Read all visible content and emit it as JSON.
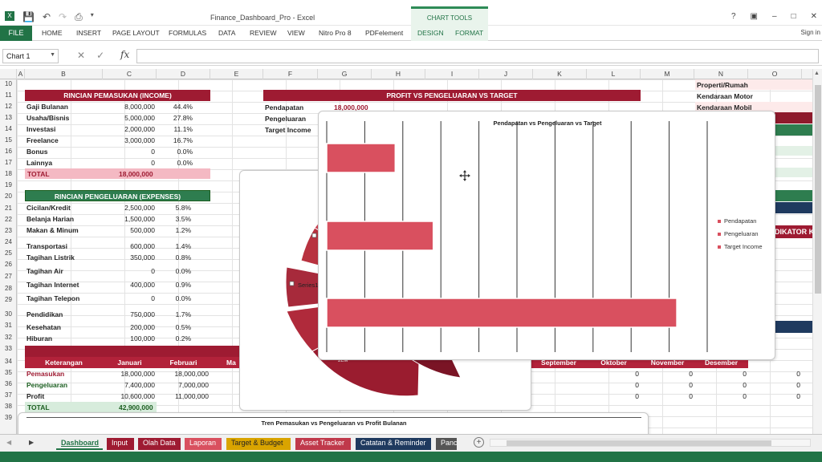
{
  "window": {
    "title": "Finance_Dashboard_Pro - Excel",
    "context_group": "CHART TOOLS",
    "controls": [
      "?",
      "▣",
      "–",
      "□",
      "✕"
    ]
  },
  "ribbon": {
    "file": "FILE",
    "tabs": [
      "HOME",
      "INSERT",
      "PAGE LAYOUT",
      "FORMULAS",
      "DATA",
      "REVIEW",
      "VIEW",
      "Nitro Pro 8",
      "PDFelement"
    ],
    "context_tabs": [
      "DESIGN",
      "FORMAT"
    ],
    "sign_in": "Sign in"
  },
  "formula_bar": {
    "name_box": "Chart 1",
    "fx": "fx",
    "value": ""
  },
  "columns": [
    "A",
    "B",
    "C",
    "D",
    "E",
    "F",
    "G",
    "H",
    "I",
    "J",
    "K",
    "L",
    "M",
    "N",
    "O"
  ],
  "rows": [
    "10",
    "11",
    "12",
    "13",
    "14",
    "15",
    "16",
    "17",
    "18",
    "19",
    "20",
    "21",
    "22",
    "23",
    "24",
    "25",
    "26",
    "27",
    "28",
    "29",
    "30",
    "31",
    "32",
    "33",
    "34",
    "35",
    "36",
    "37",
    "38",
    "39"
  ],
  "income": {
    "header": "RINCIAN PEMASUKAN (INCOME)",
    "items": [
      {
        "label": "Gaji Bulanan",
        "value": "8,000,000",
        "pct": "44.4%"
      },
      {
        "label": "Usaha/Bisnis",
        "value": "5,000,000",
        "pct": "27.8%"
      },
      {
        "label": "Investasi",
        "value": "2,000,000",
        "pct": "11.1%"
      },
      {
        "label": "Freelance",
        "value": "3,000,000",
        "pct": "16.7%"
      },
      {
        "label": "Bonus",
        "value": "0",
        "pct": "0.0%"
      },
      {
        "label": "Lainnya",
        "value": "0",
        "pct": "0.0%"
      }
    ],
    "total_label": "TOTAL",
    "total_value": "18,000,000"
  },
  "expenses": {
    "header": "RINCIAN PENGELUARAN (EXPENSES)",
    "items": [
      {
        "label": "Cicilan/Kredit",
        "value": "2,500,000",
        "pct": "5.8%"
      },
      {
        "label": "Belanja Harian",
        "value": "1,500,000",
        "pct": "3.5%"
      },
      {
        "label": "Makan & Minum",
        "value": "500,000",
        "pct": "1.2%"
      },
      {
        "label": "Transportasi",
        "value": "600,000",
        "pct": "1.4%"
      },
      {
        "label": "Tagihan Listrik",
        "value": "350,000",
        "pct": "0.8%"
      },
      {
        "label": "Tagihan Air",
        "value": "0",
        "pct": "0.0%"
      },
      {
        "label": "Tagihan Internet",
        "value": "400,000",
        "pct": "0.9%"
      },
      {
        "label": "Tagihan Telepon",
        "value": "0",
        "pct": "0.0%"
      },
      {
        "label": "Pendidikan",
        "value": "750,000",
        "pct": "1.7%"
      },
      {
        "label": "Kesehatan",
        "value": "200,000",
        "pct": "0.5%"
      },
      {
        "label": "Hiburan",
        "value": "100,000",
        "pct": "0.2%"
      }
    ]
  },
  "profit_section": {
    "header": "PROFIT VS PENGELUARAN VS TARGET",
    "rows": [
      {
        "label": "Pendapatan",
        "value": "18,000,000"
      },
      {
        "label": "Pengeluaran",
        "value": ""
      },
      {
        "label": "Target Income",
        "value": ""
      }
    ]
  },
  "assets": [
    "Properti/Rumah",
    "Kendaraan Motor",
    "Kendaraan Mobil"
  ],
  "indicator_partial": "DIKATOR K",
  "monthly": {
    "headers": [
      "Keterangan",
      "Januari",
      "Februari",
      "Ma"
    ],
    "rows": [
      {
        "label": "Pemasukan",
        "values": [
          "18,000,000",
          "18,000,000"
        ]
      },
      {
        "label": "Pengeluaran",
        "values": [
          "7,400,000",
          "7,000,000"
        ]
      },
      {
        "label": "Profit",
        "values": [
          "10,600,000",
          "11,000,000"
        ]
      }
    ],
    "total_label": "TOTAL",
    "total_value": "42,900,000",
    "right_headers": [
      "September",
      "Oktober",
      "November",
      "Desember"
    ],
    "right_values": [
      [
        "0",
        "0",
        "0",
        "0"
      ],
      [
        "0",
        "0",
        "0",
        "0"
      ],
      [
        "0",
        "0",
        "0",
        "0"
      ]
    ],
    "left_stub": [
      "0",
      "0",
      "0"
    ]
  },
  "trend_chart_title": "Tren Pemasukan vs Pengeluaran vs Profit Bulanan",
  "pie_label": "Series1",
  "pie_partial": "2EM",
  "chart_data": {
    "type": "bar",
    "title": "Pendapatan vs Pengeluaran vs Target",
    "categories": [
      "Pendapatan",
      "Pengeluaran",
      "Target Income"
    ],
    "values": [
      18000000,
      28000000,
      92000000
    ],
    "xlim": [
      0,
      100000000
    ],
    "legend": "right",
    "legend_entries": [
      "Pendapatan",
      "Pengeluaran",
      "Target Income"
    ],
    "bar_color": "#d9505f",
    "grid": true
  },
  "sheet_tabs": [
    {
      "label": "Dashboard",
      "color": "#f0f0f0",
      "text": "#217346"
    },
    {
      "label": "Input",
      "color": "#9e1b32",
      "text": "#ffffff"
    },
    {
      "label": "Olah Data",
      "color": "#9e1b32",
      "text": "#ffffff"
    },
    {
      "label": "Laporan",
      "color": "#d9505f",
      "text": "#ffffff"
    },
    {
      "label": "Target & Budget",
      "color": "#d9a400",
      "text": "#222222"
    },
    {
      "label": "Asset Tracker",
      "color": "#c0394b",
      "text": "#ffffff"
    },
    {
      "label": "Catatan & Reminder",
      "color": "#1f3a5f",
      "text": "#ffffff"
    },
    {
      "label": "Panc",
      "color": "#555555",
      "text": "#ffffff"
    }
  ],
  "colors": {
    "accent": "#217346",
    "brand_red": "#9e1b32",
    "brand_green": "#2e7d4f"
  }
}
